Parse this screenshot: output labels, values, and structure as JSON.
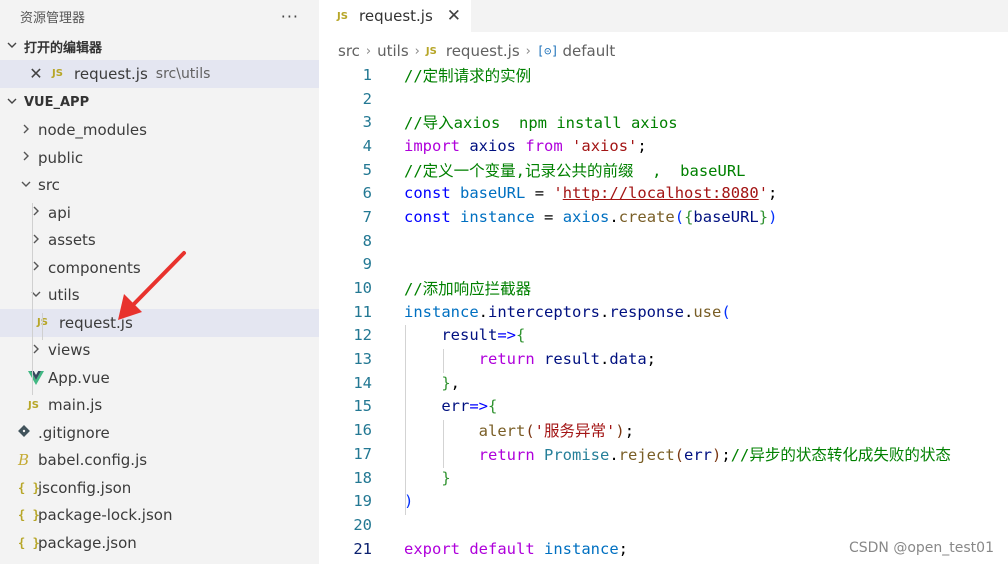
{
  "sidebar": {
    "title": "资源管理器",
    "more_label": "···",
    "open_editors": {
      "title": "打开的编辑器",
      "items": [
        {
          "name": "request.js",
          "path": "src\\utils"
        }
      ]
    },
    "project": {
      "title": "VUE_APP",
      "tree": [
        {
          "name": "node_modules"
        },
        {
          "name": "public"
        },
        {
          "name": "src"
        },
        {
          "name": "api"
        },
        {
          "name": "assets"
        },
        {
          "name": "components"
        },
        {
          "name": "utils"
        },
        {
          "name": "request.js"
        },
        {
          "name": "views"
        },
        {
          "name": "App.vue"
        },
        {
          "name": "main.js"
        },
        {
          "name": ".gitignore"
        },
        {
          "name": "babel.config.js"
        },
        {
          "name": "jsconfig.json"
        },
        {
          "name": "package-lock.json"
        },
        {
          "name": "package.json"
        }
      ]
    }
  },
  "icons": {
    "js": "JS",
    "json": "{ }",
    "vue": "vue-icon",
    "git": "git-icon",
    "babel": "B",
    "chevron_right": "chevron-right-icon",
    "chevron_down": "chevron-down-icon"
  },
  "editor": {
    "tab": {
      "label": "request.js",
      "close": "✕"
    },
    "breadcrumb": {
      "parts": [
        "src",
        "utils",
        "request.js",
        "default"
      ],
      "symbol_icon": "[⊝]"
    },
    "lines": [
      {
        "n": "1"
      },
      {
        "n": "2"
      },
      {
        "n": "3"
      },
      {
        "n": "4"
      },
      {
        "n": "5"
      },
      {
        "n": "6"
      },
      {
        "n": "7"
      },
      {
        "n": "8"
      },
      {
        "n": "9"
      },
      {
        "n": "10"
      },
      {
        "n": "11"
      },
      {
        "n": "12"
      },
      {
        "n": "13"
      },
      {
        "n": "14"
      },
      {
        "n": "15"
      },
      {
        "n": "16"
      },
      {
        "n": "17"
      },
      {
        "n": "18"
      },
      {
        "n": "19"
      },
      {
        "n": "20"
      },
      {
        "n": "21"
      }
    ],
    "code": {
      "l1": "//定制请求的实例",
      "l3": "//导入axios  npm install axios",
      "l4_kw": "import",
      "l4_id": "axios",
      "l4_from": "from",
      "l4_str": "'axios'",
      "l5": "//定义一个变量,记录公共的前缀  ,  baseURL",
      "l6_kw": "const",
      "l6_id": "baseURL",
      "l6_q1": "'",
      "l6_url": "http://localhost:8080",
      "l6_q2": "'",
      "l7_kw": "const",
      "l7_id": "instance",
      "l7_obj": "axios",
      "l7_fn": "create",
      "l7_arg": "baseURL",
      "l10": "//添加响应拦截器",
      "l11_a": "instance",
      "l11_b": "interceptors",
      "l11_c": "response",
      "l11_fn": "use",
      "l12_p": "result",
      "l13_kw": "return",
      "l13_a": "result",
      "l13_b": "data",
      "l15_p": "err",
      "l16_fn": "alert",
      "l16_str": "'服务异常'",
      "l17_kw": "return",
      "l17_t": "Promise",
      "l17_fn": "reject",
      "l17_arg": "err",
      "l17_c": "//异步的状态转化成失败的状态",
      "l21_kw1": "export",
      "l21_kw2": "default",
      "l21_id": "instance"
    }
  },
  "watermark": "CSDN @open_test01",
  "colors": {
    "sidebar_bg": "#f3f3f3",
    "selected_bg": "#e4e6f1",
    "arrow": "#e8322d",
    "comment": "#008000",
    "keyword": "#0000ff"
  }
}
